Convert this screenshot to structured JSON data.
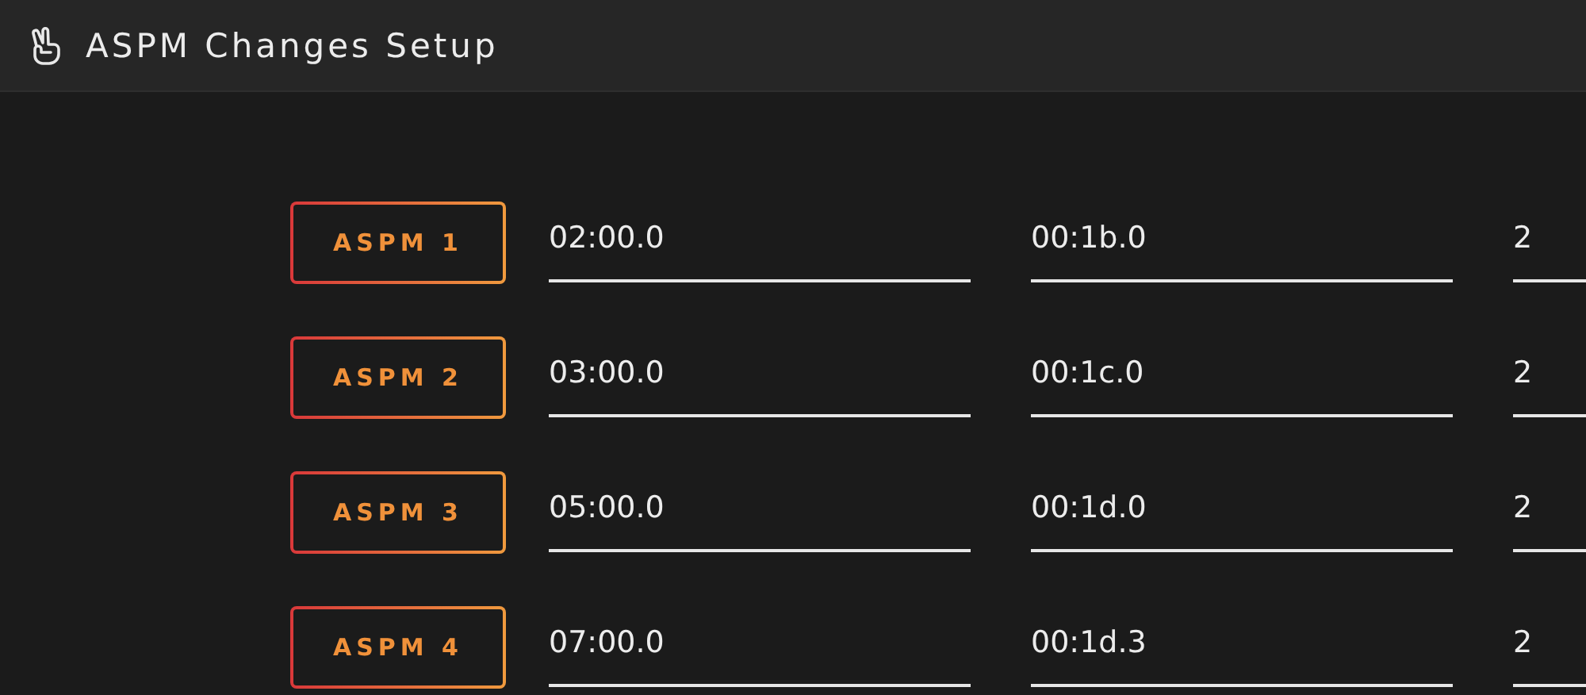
{
  "header": {
    "title": "ASPM Changes Setup"
  },
  "rows": [
    {
      "button": "ASPM 1",
      "fields": [
        "02:00.0",
        "00:1b.0",
        "2"
      ]
    },
    {
      "button": "ASPM 2",
      "fields": [
        "03:00.0",
        "00:1c.0",
        "2"
      ]
    },
    {
      "button": "ASPM 3",
      "fields": [
        "05:00.0",
        "00:1d.0",
        "2"
      ]
    },
    {
      "button": "ASPM 4",
      "fields": [
        "07:00.0",
        "00:1d.3",
        "2"
      ]
    }
  ]
}
